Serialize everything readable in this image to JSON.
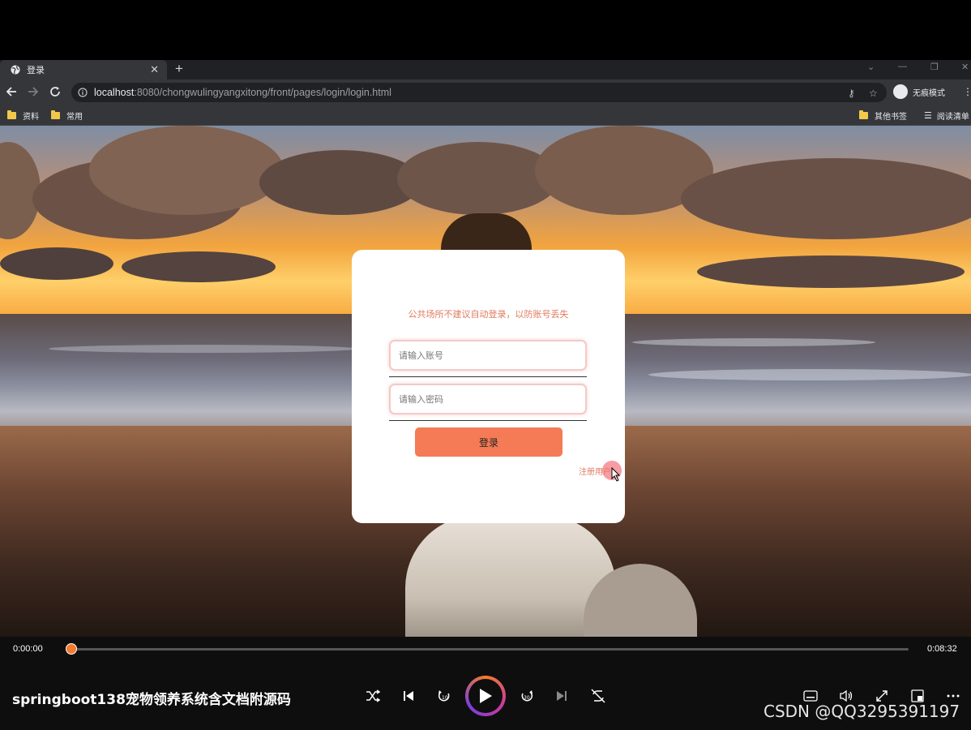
{
  "browser": {
    "tab_title": "登录",
    "url_host": "localhost",
    "url_rest": ":8080/chongwulingyangxitong/front/pages/login/login.html",
    "profile_label": "无痕模式",
    "bookmarks": [
      "资料",
      "常用"
    ],
    "bookmarks_right": [
      "其他书签",
      "阅读清单"
    ]
  },
  "login": {
    "tip": "公共场所不建议自动登录，以防账号丢失",
    "account_placeholder": "请输入账号",
    "password_placeholder": "请输入密码",
    "login_label": "登录",
    "register_label": "注册用户"
  },
  "player": {
    "current_time": "0:00:00",
    "total_time": "0:08:32",
    "progress": 0.0,
    "title": "springboot138宠物领养系统含文档附源码",
    "watermark": "CSDN @QQ3295391197"
  }
}
